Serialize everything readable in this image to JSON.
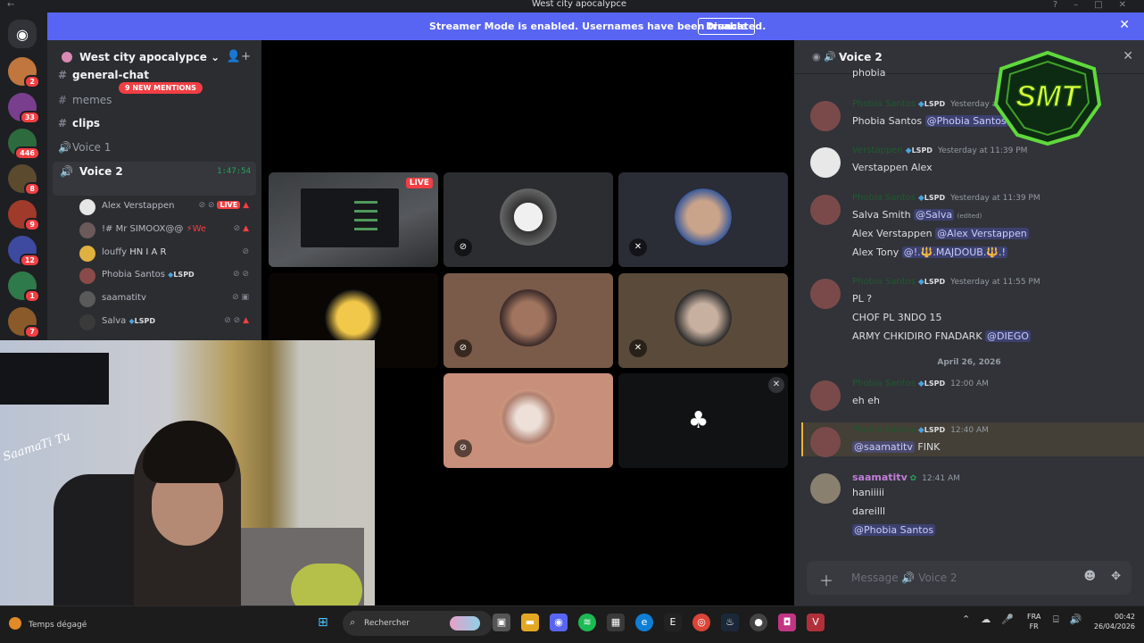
{
  "window": {
    "title": "West city apocalypce"
  },
  "banner": {
    "text": "Streamer Mode is enabled. Usernames have been truncated.",
    "button": "Disable"
  },
  "rail": {
    "badges": [
      "2",
      "33",
      "446",
      "8",
      "9",
      "12",
      "1",
      "7"
    ]
  },
  "server": {
    "name": "West city apocalypce",
    "mentions_pill": "9 NEW MENTIONS",
    "channels": [
      {
        "name": "general-chat"
      },
      {
        "name": "memes"
      },
      {
        "name": "clips"
      },
      {
        "name": "Voice 1"
      }
    ],
    "voice2": {
      "name": "Voice 2",
      "timer": "1:47:54"
    },
    "voice_users": [
      {
        "name": "Alex Verstappen",
        "live": "LIVE"
      },
      {
        "name": "!# Mr SIMOOX@@",
        "extra": "⚡We"
      },
      {
        "name": "louffy",
        "extra": "HN  I A R"
      },
      {
        "name": "Phobia Santos",
        "tag": "LSPD"
      },
      {
        "name": "saamatitv"
      },
      {
        "name": "Salva",
        "tag": "LSPD"
      }
    ]
  },
  "webcam": {
    "signature": "SaamaTi Tu"
  },
  "stage": {
    "live_label": "LIVE"
  },
  "chat": {
    "title": "Voice 2",
    "top_cut_line": "phobia",
    "messages": [
      {
        "author": "Phobia Santos",
        "tag": "LSPD",
        "time": "Yesterday at 11:31 PM",
        "lines": [
          [
            "Phobia Santos ",
            "@Phobia Santos"
          ]
        ]
      },
      {
        "author": "Verstappen",
        "tag": "LSPD",
        "time": "Yesterday at 11:39 PM",
        "lines": [
          [
            "Verstappen Alex",
            ""
          ]
        ]
      },
      {
        "author": "Phobia Santos",
        "tag": "LSPD",
        "time": "Yesterday at 11:39 PM",
        "lines": [
          [
            "Salva Smith ",
            "@Salva"
          ],
          [
            "Alex Verstappen ",
            "@Alex Verstappen"
          ],
          [
            "Alex Tony ",
            "@!.🔱.MAJDOUB.🔱.!"
          ]
        ],
        "edited": "(edited)"
      },
      {
        "author": "Phobia Santos",
        "tag": "LSPD",
        "time": "Yesterday at 11:55 PM",
        "lines": [
          [
            "PL ?",
            ""
          ],
          [
            "CHOF PL 3NDO 15",
            ""
          ],
          [
            "ARMY CHKIDIRO FNADARK ",
            "@DIEGO"
          ]
        ]
      },
      {
        "author": "Phobia Santos",
        "tag": "LSPD",
        "time": "12:00 AM",
        "lines": [
          [
            "eh eh",
            ""
          ]
        ]
      },
      {
        "author": "Phobia Santos",
        "tag": "LSPD",
        "time": "12:40 AM",
        "lines": [
          [
            "",
            "@saamatitv",
            " FINK"
          ]
        ]
      },
      {
        "author": "saamatitv",
        "time": "12:41 AM",
        "lines": [
          [
            "haniiiii",
            ""
          ],
          [
            "dareilll",
            ""
          ],
          [
            "",
            "@Phobia Santos"
          ]
        ]
      }
    ],
    "date_divider": "April 26, 2026",
    "composer_placeholder": "Message 🔊 Voice 2"
  },
  "taskbar": {
    "weather": "Temps dégagé",
    "search_placeholder": "Rechercher",
    "lang_top": "FRA",
    "lang_bottom": "FR",
    "time": "00:42",
    "date": "26/04/2026"
  },
  "colors": {
    "accent": "#5865f2",
    "live": "#f23f43",
    "voice_green": "#23a559"
  }
}
